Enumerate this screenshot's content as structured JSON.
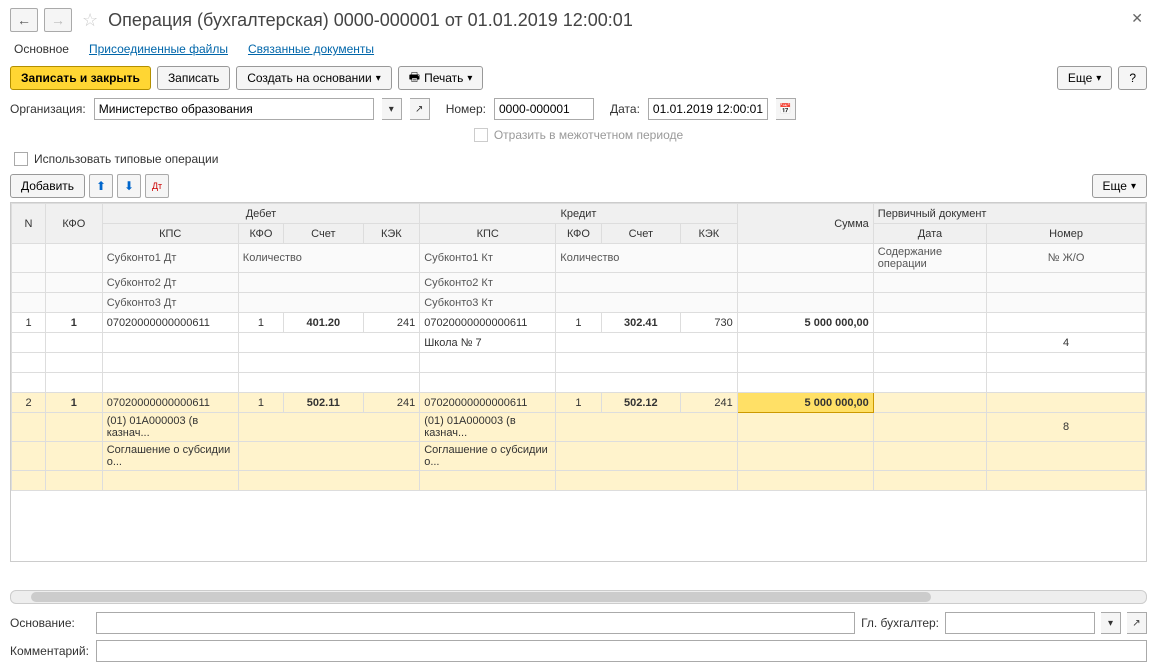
{
  "header": {
    "title": "Операция (бухгалтерская) 0000-000001 от 01.01.2019 12:00:01"
  },
  "tabs": {
    "main": "Основное",
    "files": "Присоединенные файлы",
    "related": "Связанные документы"
  },
  "toolbar": {
    "save_close": "Записать и закрыть",
    "save": "Записать",
    "create_basis": "Создать на основании",
    "print": "Печать",
    "more": "Еще",
    "help": "?"
  },
  "form": {
    "org_label": "Организация:",
    "org_value": "Министерство образования",
    "num_label": "Номер:",
    "num_value": "0000-000001",
    "date_label": "Дата:",
    "date_value": "01.01.2019 12:00:01",
    "interperiod": "Отразить в межотчетном периоде",
    "use_typical": "Использовать типовые операции"
  },
  "sec": {
    "add": "Добавить",
    "more": "Еще"
  },
  "grid": {
    "headers": {
      "n": "N",
      "kfo": "КФО",
      "debit": "Дебет",
      "credit": "Кредит",
      "sum": "Сумма",
      "primary": "Первичный документ",
      "kps": "КПС",
      "acct": "Счет",
      "kek": "КЭК",
      "date": "Дата",
      "number": "Номер",
      "sub1d": "Субконто1 Дт",
      "sub2d": "Субконто2 Дт",
      "sub3d": "Субконто3 Дт",
      "sub1k": "Субконто1 Кт",
      "sub2k": "Субконто2 Кт",
      "sub3k": "Субконто3 Кт",
      "qty": "Количество",
      "content": "Содержание операции",
      "jo": "№ Ж/О"
    },
    "rows": [
      {
        "n": "1",
        "kfo": "1",
        "d_kps": "07020000000000611",
        "d_kfo": "1",
        "d_acct": "401.20",
        "d_kek": "241",
        "k_kps": "07020000000000611",
        "k_kfo": "1",
        "k_acct": "302.41",
        "k_kek": "730",
        "sum": "5 000 000,00",
        "k_sub1": "Школа № 7",
        "jo": "4"
      },
      {
        "n": "2",
        "kfo": "1",
        "d_kps": "07020000000000611",
        "d_kfo": "1",
        "d_acct": "502.11",
        "d_kek": "241",
        "k_kps": "07020000000000611",
        "k_kfo": "1",
        "k_acct": "502.12",
        "k_kek": "241",
        "sum": "5 000 000,00",
        "d_sub1": "(01) 01А000003 (в казнач...",
        "d_sub2": "Соглашение о субсидии о...",
        "k_sub1": "(01) 01А000003 (в казнач...",
        "k_sub2": "Соглашение о субсидии о...",
        "jo": "8"
      }
    ]
  },
  "footer": {
    "basis": "Основание:",
    "chief": "Гл. бухгалтер:",
    "comment": "Комментарий:"
  }
}
